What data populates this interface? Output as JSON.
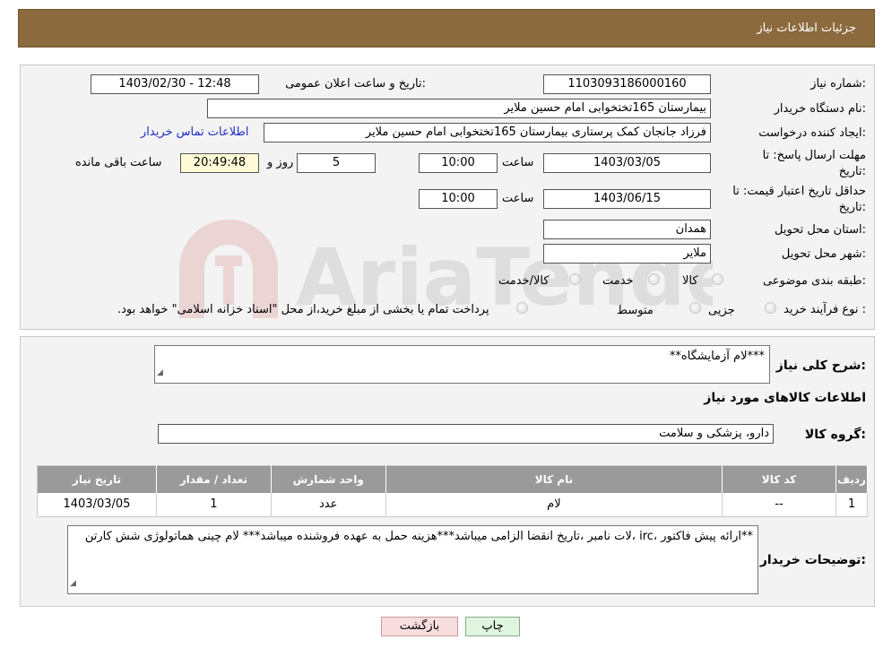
{
  "header": {
    "title": "جزئیات اطلاعات نیاز"
  },
  "fields": {
    "need_number_label": "شماره نیاز:",
    "need_number": "1103093186000160",
    "announce_label": "تاریخ و ساعت اعلان عمومی:",
    "announce_value": "1403/02/30 - 12:48",
    "buyer_org_label": "نام دستگاه خریدار:",
    "buyer_org": "بیمارستان 165تختخوابی امام حسین ملایر",
    "creator_label": "ایجاد کننده درخواست:",
    "creator": "فرزاد جانجان کمک پرستاری بیمارستان 165تختخوابی امام حسین ملایر",
    "contact_link": "اطلاعات تماس خریدار",
    "deadline_label_1": "مهلت ارسال پاسخ: تا",
    "deadline_label_2": "تاریخ:",
    "deadline_date": "1403/03/05",
    "time_label": "ساعت",
    "deadline_time": "10:00",
    "days": "5",
    "days_label": "روز و",
    "remaining_time": "20:49:48",
    "remaining_label": "ساعت باقی مانده",
    "validity_label_1": "حداقل تاریخ اعتبار قیمت: تا",
    "validity_label_2": "تاریخ:",
    "validity_date": "1403/06/15",
    "validity_time": "10:00",
    "province_label": "استان محل تحویل:",
    "province": "همدان",
    "city_label": "شهر محل تحویل:",
    "city": "ملایر",
    "category_label": "طبقه بندی موضوعی:",
    "category_options": [
      "کالا",
      "خدمت",
      "کالا/خدمت"
    ],
    "process_label": "نوع فرآیند خرید :",
    "process_options": [
      "جزیی",
      "متوسط"
    ],
    "payment_note": "پرداخت تمام یا بخشی از مبلغ خرید،از محل \"اسناد خزانه اسلامی\" خواهد بود."
  },
  "summary": {
    "label": "شرح کلی نیاز:",
    "value": "***لام آزمایشگاه**"
  },
  "goods": {
    "section_title": "اطلاعات کالاهای مورد نیاز",
    "group_label": "گروه کالا:",
    "group_value": "دارو، پزشکی و سلامت",
    "columns": [
      "ردیف",
      "کد کالا",
      "نام کالا",
      "واحد شمارش",
      "تعداد / مقدار",
      "تاریخ نیاز"
    ],
    "rows": [
      [
        "1",
        "--",
        "لام",
        "عدد",
        "1",
        "1403/03/05"
      ]
    ]
  },
  "buyer_notes": {
    "label": "توضیحات خریدار:",
    "value": "**ارائه پیش فاکتور ،irc ،لات نامبر ،تاریخ انقضا الزامی میباشد***هزینه حمل به عهده فروشنده میباشد*** لام چینی هماتولوژی  شش کارتن"
  },
  "buttons": {
    "print": "چاپ",
    "back": "بازگشت"
  },
  "watermark": "AriaTender.neT",
  "colors": {
    "header": "#8b6a3e",
    "link": "#1a2ec6",
    "back_button": "#f8dede",
    "print_button": "#dff5df",
    "remaining_time_bg": "#fffbd6"
  }
}
